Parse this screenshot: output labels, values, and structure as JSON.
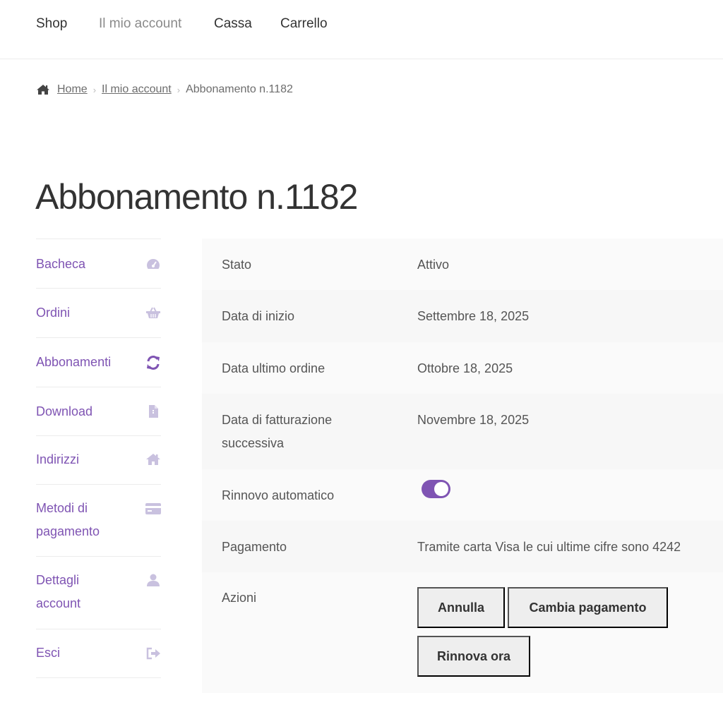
{
  "nav": {
    "items": [
      {
        "label": "Shop"
      },
      {
        "label": "Il mio account"
      },
      {
        "label": "Cassa"
      },
      {
        "label": "Carrello"
      }
    ]
  },
  "breadcrumb": {
    "items": [
      "Home",
      "Il mio account",
      "Abbonamento n.1182"
    ],
    "separator": "›"
  },
  "page": {
    "title": "Abbonamento n.1182"
  },
  "sidebar": {
    "items": [
      {
        "label": "Bacheca",
        "icon": "dashboard-icon"
      },
      {
        "label": "Ordini",
        "icon": "basket-icon"
      },
      {
        "label": "Abbonamenti",
        "icon": "refresh-icon"
      },
      {
        "label": "Download",
        "icon": "file-icon"
      },
      {
        "label": "Indirizzi",
        "icon": "home-icon"
      },
      {
        "label": "Metodi di pagamento",
        "icon": "credit-card-icon"
      },
      {
        "label": "Dettagli account",
        "icon": "user-icon"
      },
      {
        "label": "Esci",
        "icon": "sign-out-icon"
      }
    ]
  },
  "details": {
    "status": {
      "key": "Stato",
      "value": "Attivo"
    },
    "start_date": {
      "key": "Data di inizio",
      "value": "Settembre 18, 2025"
    },
    "last_order": {
      "key": "Data ultimo ordine",
      "value": "Ottobre 18, 2025"
    },
    "next_billing": {
      "key": "Data di fatturazione successiva",
      "value": "Novembre 18, 2025"
    },
    "auto_renew": {
      "key": "Rinnovo automatico",
      "enabled": true
    },
    "payment": {
      "key": "Pagamento",
      "value": "Tramite carta Visa le cui ultime cifre sono 4242"
    },
    "actions": {
      "key": "Azioni",
      "cancel": "Annulla",
      "change_payment": "Cambia pagamento",
      "renew_now": "Rinnova ora"
    }
  },
  "colors": {
    "accent": "#7f54b3",
    "sidebar_icon": "#c9c1df",
    "text": "#555555"
  }
}
